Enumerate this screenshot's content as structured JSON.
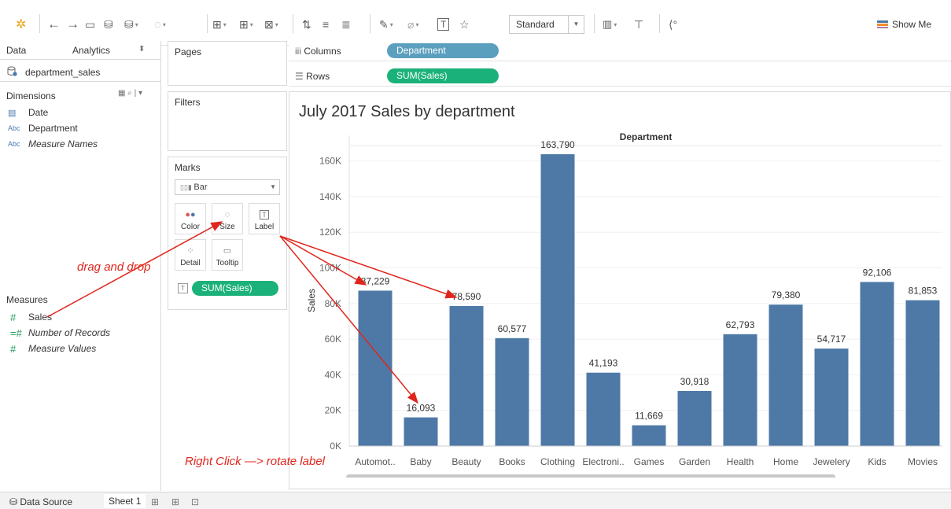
{
  "toolbar": {
    "fit_label": "Standard",
    "show_me_label": "Show Me"
  },
  "data_pane": {
    "tab_data": "Data",
    "tab_analytics": "Analytics",
    "datasource": "department_sales",
    "dimensions_title": "Dimensions",
    "dimensions": [
      {
        "type": "date",
        "label": "Date"
      },
      {
        "type": "Abc",
        "label": "Department"
      },
      {
        "type": "Abc",
        "label": "Measure Names"
      }
    ],
    "measures_title": "Measures",
    "measures": [
      {
        "label": "Sales"
      },
      {
        "label": "Number of Records"
      },
      {
        "label": "Measure Values"
      }
    ]
  },
  "shelves": {
    "pages": "Pages",
    "filters": "Filters",
    "marks": "Marks",
    "mark_type": "Bar",
    "color": "Color",
    "size": "Size",
    "label": "Label",
    "detail": "Detail",
    "tooltip": "Tooltip",
    "marks_pill": "SUM(Sales)",
    "columns_label": "Columns",
    "columns_pill": "Department",
    "rows_label": "Rows",
    "rows_pill": "SUM(Sales)"
  },
  "annotations": {
    "drag": "drag and drop",
    "rotate": "Right Click —> rotate label"
  },
  "bottom": {
    "data_source": "Data Source",
    "sheet": "Sheet 1"
  },
  "colors": {
    "bar": "#4e79a7",
    "columns_pill": "#5b9fbf",
    "rows_pill": "#1bb17a",
    "annotation": "#e0261c"
  },
  "chart_data": {
    "type": "bar",
    "title": "July 2017 Sales by department",
    "header": "Department",
    "ylabel": "Sales",
    "ylim": [
      0,
      170000
    ],
    "yticks": [
      "0K",
      "20K",
      "40K",
      "60K",
      "80K",
      "100K",
      "120K",
      "140K",
      "160K"
    ],
    "categories": [
      "Automot..",
      "Baby",
      "Beauty",
      "Books",
      "Clothing",
      "Electroni..",
      "Games",
      "Garden",
      "Health",
      "Home",
      "Jewelery",
      "Kids",
      "Movies"
    ],
    "values": [
      87229,
      16093,
      78590,
      60577,
      163790,
      41193,
      11669,
      30918,
      62793,
      79380,
      54717,
      92106,
      81853
    ],
    "value_labels": [
      "87,229",
      "16,093",
      "78,590",
      "60,577",
      "163,790",
      "41,193",
      "11,669",
      "30,918",
      "62,793",
      "79,380",
      "54,717",
      "92,106",
      "81,853"
    ]
  }
}
